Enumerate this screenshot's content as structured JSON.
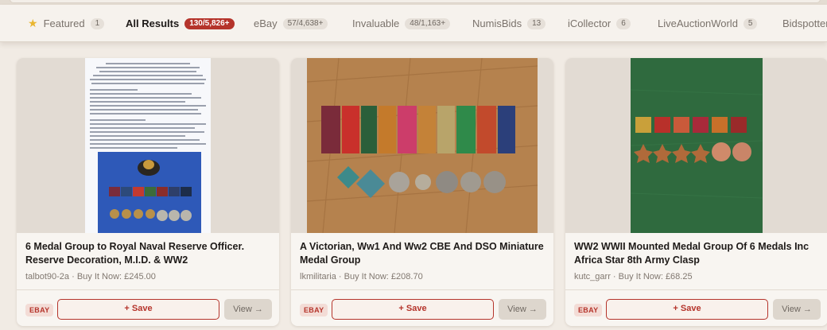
{
  "tabs": [
    {
      "label": "Featured",
      "count": "1",
      "icon": "star-icon"
    },
    {
      "label": "All Results",
      "count": "130/5,826+",
      "active": true
    },
    {
      "label": "eBay",
      "count": "57/4,638+"
    },
    {
      "label": "Invaluable",
      "count": "48/1,163+"
    },
    {
      "label": "NumisBids",
      "count": "13"
    },
    {
      "label": "iCollector",
      "count": "6"
    },
    {
      "label": "LiveAuctionWorld",
      "count": "5"
    },
    {
      "label": "Bidspotter",
      "count": ""
    }
  ],
  "colors": {
    "accent": "#b5342b",
    "background": "#f1ebe4",
    "card": "#f8f5f1"
  },
  "cards": [
    {
      "title": "6 Medal Group to Royal Naval Reserve Officer. Reserve Decoration, M.I.D. & WW2",
      "seller": "talbot90-2a",
      "price": "Buy It Now: £245.00",
      "source": "EBAY",
      "save_label": "+ Save",
      "view_label": "View →"
    },
    {
      "title": "A Victorian, Ww1 And Ww2 CBE And DSO Miniature Medal Group",
      "seller": "lkmilitaria",
      "price": "Buy It Now: £208.70",
      "source": "EBAY",
      "save_label": "+ Save",
      "view_label": "View →"
    },
    {
      "title": "WW2 WWII Mounted Medal Group Of 6 Medals Inc Africa Star 8th Army Clasp",
      "seller": "kutc_garr",
      "price": "Buy It Now: £68.25",
      "source": "EBAY",
      "save_label": "+ Save",
      "view_label": "View →"
    }
  ]
}
